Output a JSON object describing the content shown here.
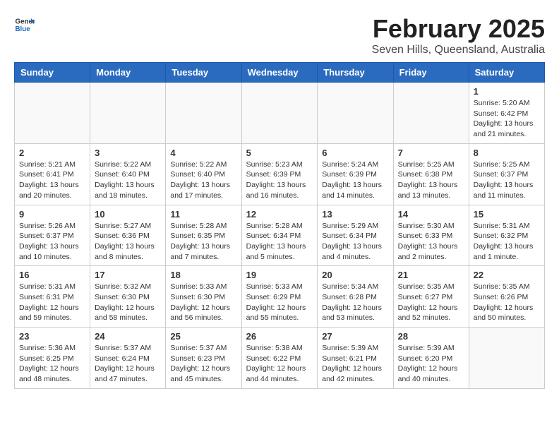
{
  "logo": {
    "line1": "General",
    "line2": "Blue"
  },
  "title": "February 2025",
  "subtitle": "Seven Hills, Queensland, Australia",
  "days_of_week": [
    "Sunday",
    "Monday",
    "Tuesday",
    "Wednesday",
    "Thursday",
    "Friday",
    "Saturday"
  ],
  "weeks": [
    [
      {
        "day": "",
        "info": ""
      },
      {
        "day": "",
        "info": ""
      },
      {
        "day": "",
        "info": ""
      },
      {
        "day": "",
        "info": ""
      },
      {
        "day": "",
        "info": ""
      },
      {
        "day": "",
        "info": ""
      },
      {
        "day": "1",
        "info": "Sunrise: 5:20 AM\nSunset: 6:42 PM\nDaylight: 13 hours\nand 21 minutes."
      }
    ],
    [
      {
        "day": "2",
        "info": "Sunrise: 5:21 AM\nSunset: 6:41 PM\nDaylight: 13 hours\nand 20 minutes."
      },
      {
        "day": "3",
        "info": "Sunrise: 5:22 AM\nSunset: 6:40 PM\nDaylight: 13 hours\nand 18 minutes."
      },
      {
        "day": "4",
        "info": "Sunrise: 5:22 AM\nSunset: 6:40 PM\nDaylight: 13 hours\nand 17 minutes."
      },
      {
        "day": "5",
        "info": "Sunrise: 5:23 AM\nSunset: 6:39 PM\nDaylight: 13 hours\nand 16 minutes."
      },
      {
        "day": "6",
        "info": "Sunrise: 5:24 AM\nSunset: 6:39 PM\nDaylight: 13 hours\nand 14 minutes."
      },
      {
        "day": "7",
        "info": "Sunrise: 5:25 AM\nSunset: 6:38 PM\nDaylight: 13 hours\nand 13 minutes."
      },
      {
        "day": "8",
        "info": "Sunrise: 5:25 AM\nSunset: 6:37 PM\nDaylight: 13 hours\nand 11 minutes."
      }
    ],
    [
      {
        "day": "9",
        "info": "Sunrise: 5:26 AM\nSunset: 6:37 PM\nDaylight: 13 hours\nand 10 minutes."
      },
      {
        "day": "10",
        "info": "Sunrise: 5:27 AM\nSunset: 6:36 PM\nDaylight: 13 hours\nand 8 minutes."
      },
      {
        "day": "11",
        "info": "Sunrise: 5:28 AM\nSunset: 6:35 PM\nDaylight: 13 hours\nand 7 minutes."
      },
      {
        "day": "12",
        "info": "Sunrise: 5:28 AM\nSunset: 6:34 PM\nDaylight: 13 hours\nand 5 minutes."
      },
      {
        "day": "13",
        "info": "Sunrise: 5:29 AM\nSunset: 6:34 PM\nDaylight: 13 hours\nand 4 minutes."
      },
      {
        "day": "14",
        "info": "Sunrise: 5:30 AM\nSunset: 6:33 PM\nDaylight: 13 hours\nand 2 minutes."
      },
      {
        "day": "15",
        "info": "Sunrise: 5:31 AM\nSunset: 6:32 PM\nDaylight: 13 hours\nand 1 minute."
      }
    ],
    [
      {
        "day": "16",
        "info": "Sunrise: 5:31 AM\nSunset: 6:31 PM\nDaylight: 12 hours\nand 59 minutes."
      },
      {
        "day": "17",
        "info": "Sunrise: 5:32 AM\nSunset: 6:30 PM\nDaylight: 12 hours\nand 58 minutes."
      },
      {
        "day": "18",
        "info": "Sunrise: 5:33 AM\nSunset: 6:30 PM\nDaylight: 12 hours\nand 56 minutes."
      },
      {
        "day": "19",
        "info": "Sunrise: 5:33 AM\nSunset: 6:29 PM\nDaylight: 12 hours\nand 55 minutes."
      },
      {
        "day": "20",
        "info": "Sunrise: 5:34 AM\nSunset: 6:28 PM\nDaylight: 12 hours\nand 53 minutes."
      },
      {
        "day": "21",
        "info": "Sunrise: 5:35 AM\nSunset: 6:27 PM\nDaylight: 12 hours\nand 52 minutes."
      },
      {
        "day": "22",
        "info": "Sunrise: 5:35 AM\nSunset: 6:26 PM\nDaylight: 12 hours\nand 50 minutes."
      }
    ],
    [
      {
        "day": "23",
        "info": "Sunrise: 5:36 AM\nSunset: 6:25 PM\nDaylight: 12 hours\nand 48 minutes."
      },
      {
        "day": "24",
        "info": "Sunrise: 5:37 AM\nSunset: 6:24 PM\nDaylight: 12 hours\nand 47 minutes."
      },
      {
        "day": "25",
        "info": "Sunrise: 5:37 AM\nSunset: 6:23 PM\nDaylight: 12 hours\nand 45 minutes."
      },
      {
        "day": "26",
        "info": "Sunrise: 5:38 AM\nSunset: 6:22 PM\nDaylight: 12 hours\nand 44 minutes."
      },
      {
        "day": "27",
        "info": "Sunrise: 5:39 AM\nSunset: 6:21 PM\nDaylight: 12 hours\nand 42 minutes."
      },
      {
        "day": "28",
        "info": "Sunrise: 5:39 AM\nSunset: 6:20 PM\nDaylight: 12 hours\nand 40 minutes."
      },
      {
        "day": "",
        "info": ""
      }
    ]
  ]
}
